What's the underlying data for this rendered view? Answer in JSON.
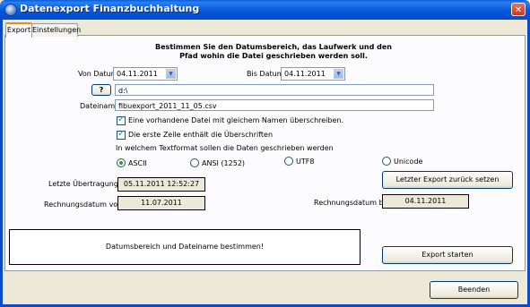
{
  "window": {
    "title": "Datenexport Finanzbuchhaltung",
    "close_glyph": "✕"
  },
  "tabs": [
    {
      "label": "Export"
    },
    {
      "label": "Einstellungen"
    }
  ],
  "intro": {
    "line1": "Bestimmen Sie den Datumsbereich, das Laufwerk und den",
    "line2": "Pfad wohin die Datei geschrieben werden soll."
  },
  "von_datum": {
    "label": "Von Datum",
    "value": "04.11.2011"
  },
  "bis_datum": {
    "label": "Bis Datum",
    "value": "04.11.2011"
  },
  "path": {
    "button_label": "?",
    "value": "d:\\"
  },
  "dateiname": {
    "label": "Dateiname",
    "value": "fibuexport_2011_11_05.csv"
  },
  "options": {
    "overwrite_label": "Eine vorhandene Datei mit gleichem Namen überschreiben.",
    "header_row_label": "Die erste Zeile enthält die Überschriften",
    "overwrite_checked": true,
    "header_row_checked": true
  },
  "format": {
    "prompt": "In welchem Textformat sollen die Daten geschrieben werden",
    "options": [
      "ASCII",
      "ANSI (1252)",
      "UTF8",
      "Unicode"
    ],
    "selected": "ASCII"
  },
  "letzte_uebertragung": {
    "label": "Letzte Übertragung",
    "value": "05.11.2011 12:52:27"
  },
  "reset_button": {
    "label": "Letzter Export zurück setzen"
  },
  "rechnungsdatum_von": {
    "label": "Rechnungsdatum von",
    "value": "11.07.2011"
  },
  "rechnungsdatum_bis": {
    "label": "Rechnungsdatum bis",
    "value": "04.11.2011"
  },
  "status": {
    "message": "Datumsbereich und Dateiname bestimmen!"
  },
  "export_button": {
    "label": "Export starten"
  },
  "close_button": {
    "label": "Beenden"
  },
  "colors": {
    "titlebar": "#0a4cc8",
    "window_bg": "#ece9d8",
    "panel_bg": "#fcfcfe",
    "checkmark": "#21a121"
  }
}
